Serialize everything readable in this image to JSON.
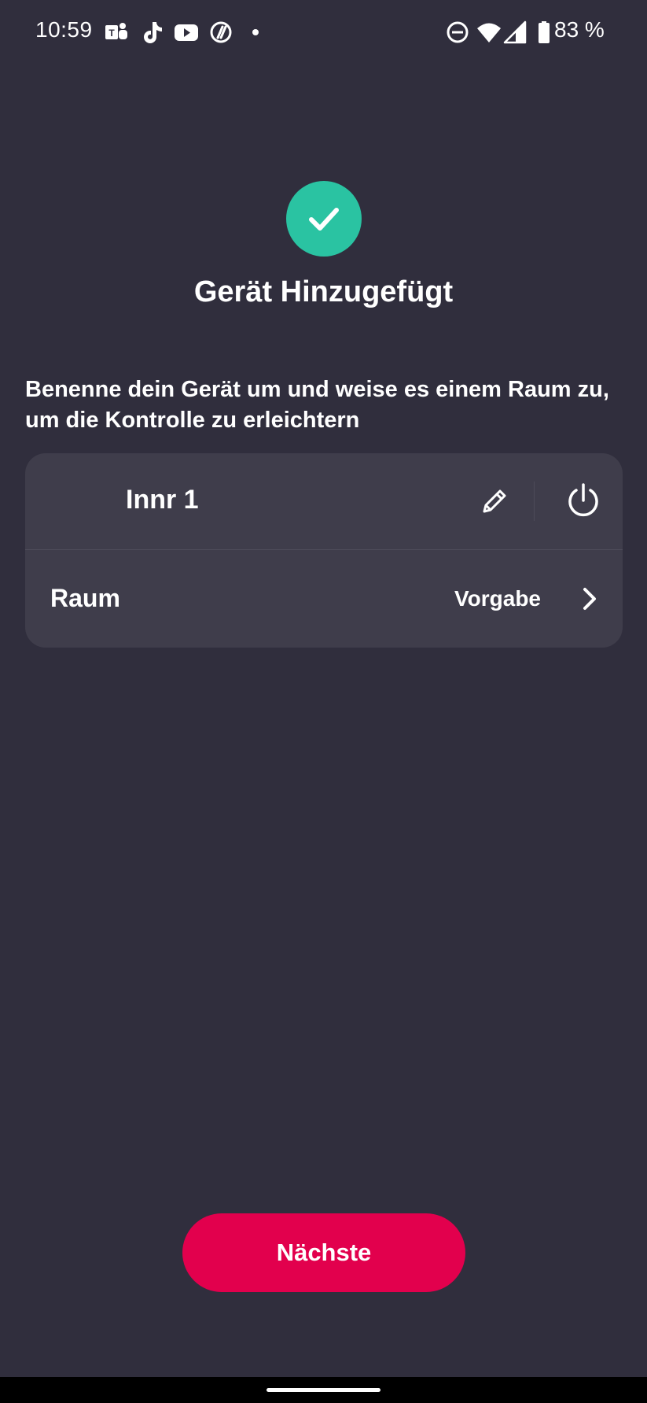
{
  "status_bar": {
    "time": "10:59",
    "battery_percent": "83 %",
    "notification_icons": [
      "teams-icon",
      "tiktok-icon",
      "youtube-icon",
      "app-icon",
      "dot-icon"
    ],
    "system_icons": [
      "do-not-disturb-icon",
      "wifi-icon",
      "signal-icon",
      "battery-icon"
    ]
  },
  "header": {
    "success_icon": "check-circle-icon",
    "title": "Gerät Hinzugefügt"
  },
  "instructions": "Benenne dein Gerät um und weise es einem Raum zu, um die Kontrolle zu erleichtern",
  "device_card": {
    "device_name": "Innr 1",
    "edit_icon": "pencil-icon",
    "power_icon": "power-icon",
    "room_label": "Raum",
    "room_value": "Vorgabe",
    "room_chevron_icon": "chevron-right-icon"
  },
  "footer": {
    "next_label": "Nächste"
  },
  "colors": {
    "background": "#302e3d",
    "card": "#3f3d4b",
    "success": "#2ac3a2",
    "primary_button": "#e2004d"
  }
}
